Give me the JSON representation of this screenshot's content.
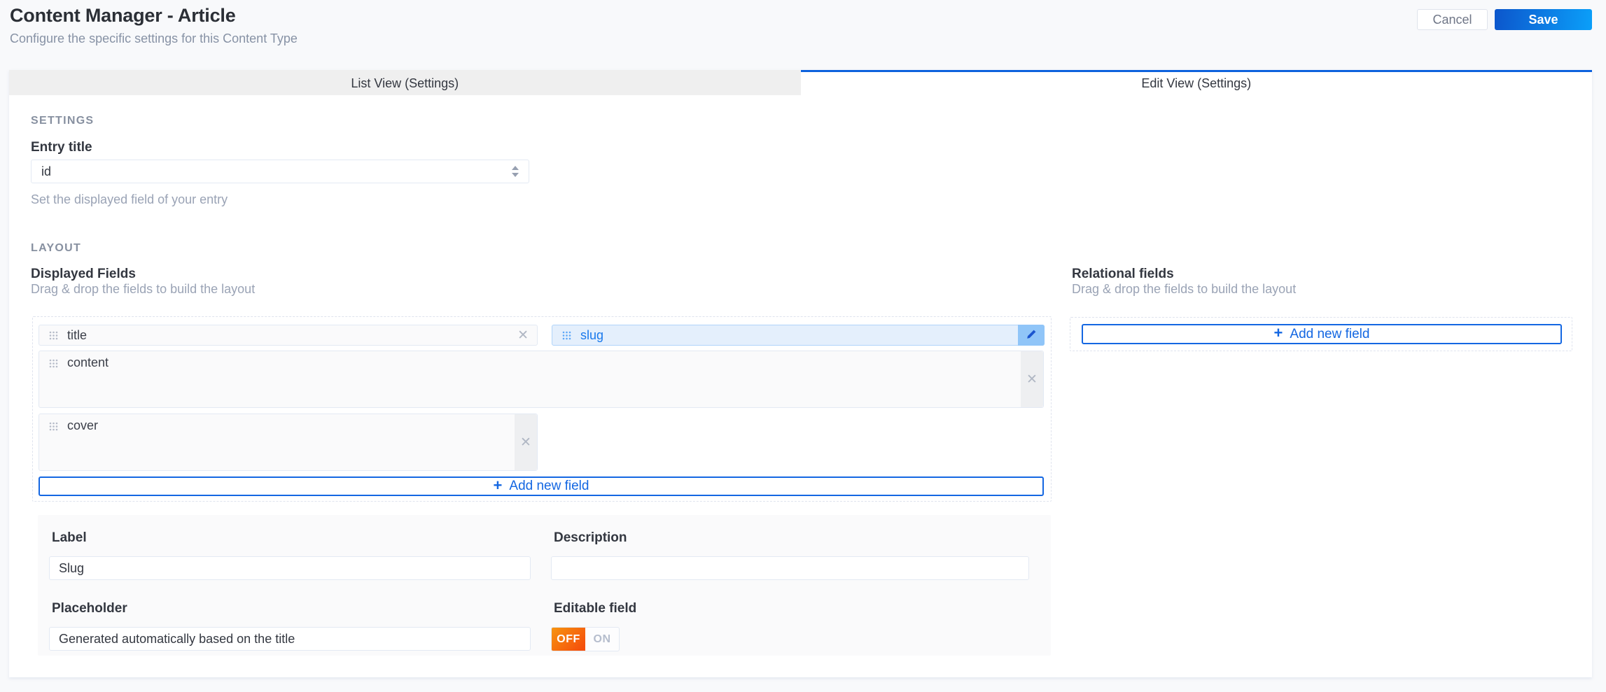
{
  "header": {
    "title": "Content Manager - Article",
    "subtitle": "Configure the specific settings for this Content Type",
    "cancel_label": "Cancel",
    "save_label": "Save"
  },
  "tabs": {
    "list_view_label": "List View (Settings)",
    "edit_view_label": "Edit View (Settings)",
    "active_tab": "Edit View (Settings)"
  },
  "settings": {
    "section_title": "SETTINGS",
    "entry_title_label": "Entry title",
    "entry_title_value": "id",
    "entry_title_help": "Set the displayed field of your entry"
  },
  "layout": {
    "section_title": "LAYOUT",
    "displayed_fields": {
      "title": "Displayed Fields",
      "subtitle": "Drag & drop the fields to build the layout",
      "fields": [
        {
          "name": "title",
          "selected": false
        },
        {
          "name": "slug",
          "selected": true
        },
        {
          "name": "content",
          "selected": false
        },
        {
          "name": "cover",
          "selected": false
        }
      ],
      "add_label": "Add new field"
    },
    "relational_fields": {
      "title": "Relational fields",
      "subtitle": "Drag & drop the fields to build the layout",
      "add_label": "Add new field"
    }
  },
  "field_form": {
    "label_label": "Label",
    "label_value": "Slug",
    "description_label": "Description",
    "description_value": "",
    "placeholder_label": "Placeholder",
    "placeholder_value": "Generated automatically based on the title",
    "editable_label": "Editable field",
    "toggle": {
      "off_label": "OFF",
      "on_label": "ON",
      "value": "OFF"
    }
  },
  "icons": {
    "drag_handle": "nine-dot-grid",
    "close": "✕",
    "edit": "pencil",
    "add": "+",
    "select_stepper": "up-down-arrows"
  },
  "colors": {
    "accent_blue": "#1467e2",
    "tab_active_border": "#0d62dd",
    "save_gradient_start": "#0c56cc",
    "save_gradient_end": "#0b9ff9",
    "selected_field_bg": "#e4effc",
    "selected_field_border": "#b0d4fa",
    "toggle_off_gradient_start": "#f79410",
    "toggle_off_gradient_end": "#f5500c",
    "panel_bg": "#fafafb",
    "field_border": "#e3e9f3"
  }
}
